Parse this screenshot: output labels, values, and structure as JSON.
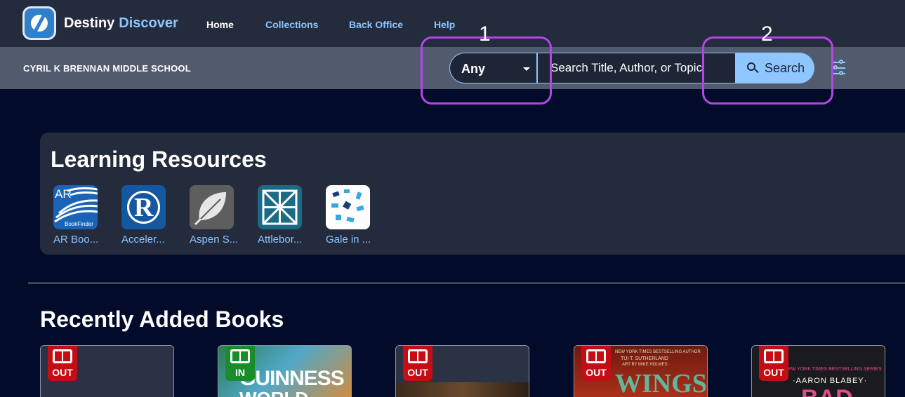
{
  "brand": {
    "name": "Destiny",
    "accent": "Discover"
  },
  "nav": [
    "Home",
    "Collections",
    "Back Office",
    "Help"
  ],
  "school": "CYRIL K BRENNAN MIDDLE SCHOOL",
  "search": {
    "scope": "Any",
    "placeholder": "Search Title, Author, or Topic",
    "button": "Search"
  },
  "annotations": [
    "1",
    "2"
  ],
  "learning_resources": {
    "title": "Learning Resources",
    "items": [
      {
        "label": "AR Boo...",
        "tile_text": "AR",
        "tile_sub": "BookFinder"
      },
      {
        "label": "Acceler...",
        "tile_text": "R"
      },
      {
        "label": "Aspen S..."
      },
      {
        "label": "Attlebor..."
      },
      {
        "label": "Gale in ..."
      }
    ]
  },
  "recent_books": {
    "title": "Recently Added Books",
    "items": [
      {
        "status": "OUT"
      },
      {
        "status": "IN",
        "cover_text": "GUINNESS",
        "cover_text2": "WORLD"
      },
      {
        "status": "OUT"
      },
      {
        "status": "OUT",
        "cover_top": "NEW YORK TIMES BESTSELLING AUTHOR",
        "cover_author": "TUI T. SUTHERLAND",
        "cover_art": "ART BY MIKE HOLMES",
        "cover_title": "WINGS"
      },
      {
        "status": "OUT",
        "cover_top": "NEW YORK TIMES BESTSELLING SERIES",
        "cover_author": "·AARON BLABEY·",
        "cover_title": "BAD"
      }
    ]
  },
  "colors": {
    "page_bg": "#020c2a",
    "nav_bg": "#232b3d",
    "subbar_bg": "#525b6e",
    "accent": "#8ec6ff",
    "annotation": "#b546e5",
    "out": "#c40d15",
    "in": "#198d2c"
  }
}
